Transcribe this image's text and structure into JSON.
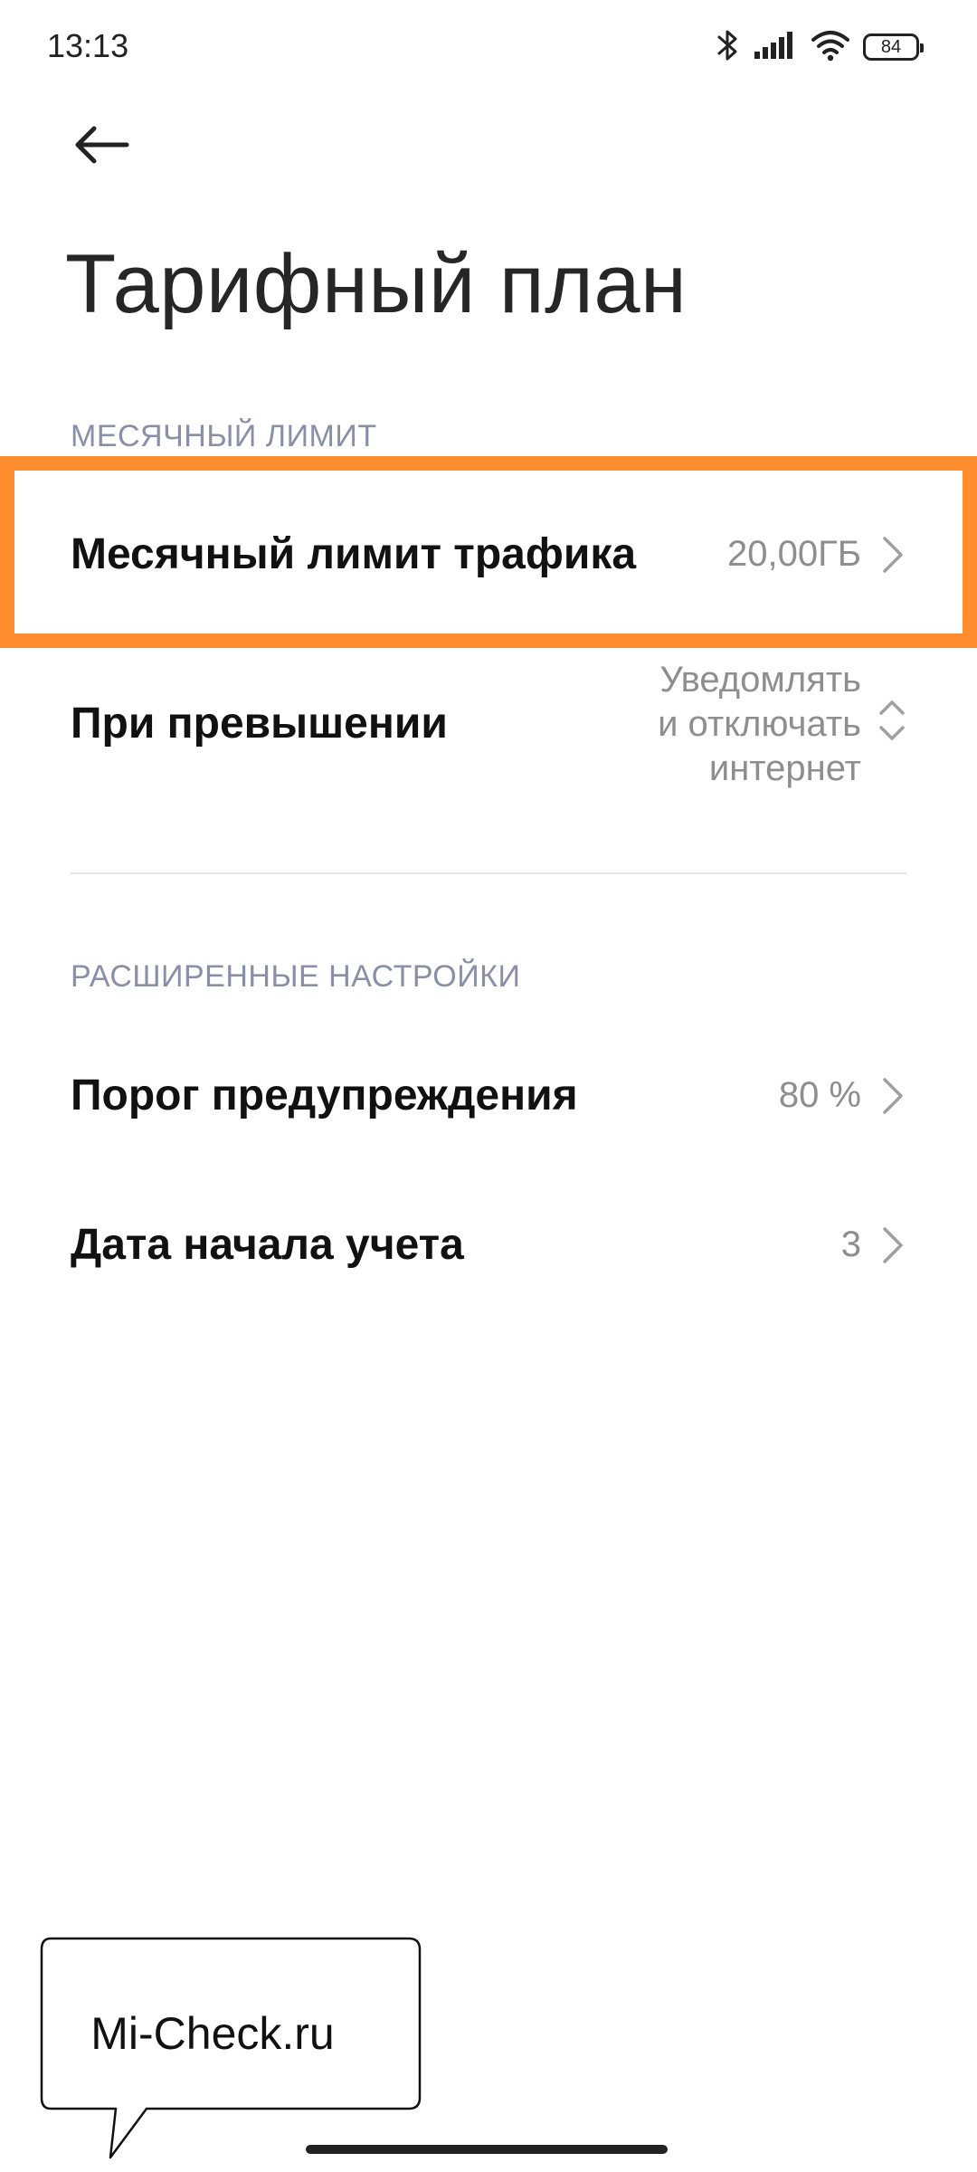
{
  "status_bar": {
    "time": "13:13",
    "battery": "84",
    "icons": [
      "bluetooth-icon",
      "signal-icon",
      "wifi-icon",
      "battery-icon"
    ]
  },
  "header": {
    "back_icon": "arrow-left-icon",
    "title": "Тарифный план"
  },
  "sections": [
    {
      "header": "МЕСЯЧНЫЙ ЛИМИТ",
      "items": [
        {
          "label": "Месячный лимит трафика",
          "value": "20,00ГБ",
          "control": "chevron-right-icon",
          "highlighted": true
        },
        {
          "label": "При превышении",
          "value_lines": [
            "Уведомлять",
            "и отключать",
            "интернет"
          ],
          "control": "chevron-up-down-icon"
        }
      ]
    },
    {
      "header": "РАСШИРЕННЫЕ НАСТРОЙКИ",
      "items": [
        {
          "label": "Порог предупреждения",
          "value": "80 %",
          "control": "chevron-right-icon"
        },
        {
          "label": "Дата начала учета",
          "value": "3",
          "control": "chevron-right-icon"
        }
      ]
    }
  ],
  "watermark": {
    "text": "Mi-Check.ru"
  },
  "colors": {
    "highlight": "#ff8c2f",
    "section_header": "#8a8fa8",
    "value_text": "#8e8e8e"
  }
}
